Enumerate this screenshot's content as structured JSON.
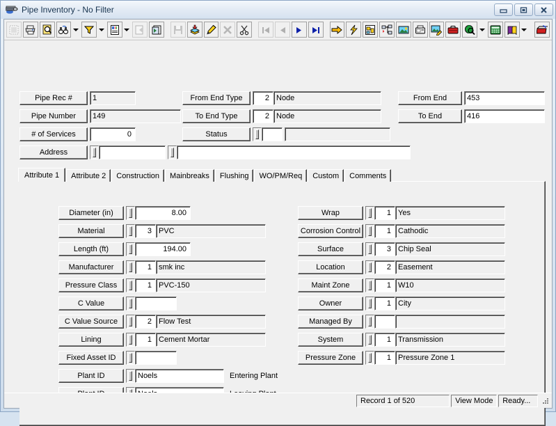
{
  "window": {
    "title": "Pipe Inventory - No Filter",
    "icon": "pipe-icon",
    "buttons": [
      {
        "name": "minimize-button",
        "glyph": "minimize"
      },
      {
        "name": "maximize-button",
        "glyph": "maximize"
      },
      {
        "name": "close-button",
        "glyph": "close"
      }
    ]
  },
  "toolbar": {
    "items": [
      {
        "name": "new-record-button",
        "icon": "grid-icon",
        "enabled": false,
        "framed": true
      },
      {
        "name": "print-button",
        "icon": "printer-icon",
        "enabled": true,
        "framed": true
      },
      {
        "name": "print-preview-button",
        "icon": "print-preview-icon",
        "enabled": true,
        "framed": true
      },
      {
        "name": "find-button",
        "icon": "binoculars-icon",
        "enabled": true,
        "framed": true
      },
      {
        "name": "find-dropdown",
        "icon": "chevron-down-icon",
        "enabled": true,
        "framed": false
      },
      {
        "name": "filter-button",
        "icon": "funnel-icon",
        "enabled": true,
        "framed": true
      },
      {
        "name": "filter-dropdown",
        "icon": "chevron-down-icon",
        "enabled": true,
        "framed": false
      },
      {
        "name": "report-button",
        "icon": "report-icon",
        "enabled": true,
        "framed": true
      },
      {
        "name": "report-dropdown",
        "icon": "chevron-down-icon",
        "enabled": true,
        "framed": false
      },
      {
        "name": "export-button",
        "icon": "export-icon",
        "enabled": false,
        "framed": true
      },
      {
        "name": "duplicate-record-button",
        "icon": "copy-records-icon",
        "enabled": true,
        "framed": true
      },
      {
        "name": "separator",
        "icon": "separator",
        "enabled": true,
        "framed": false
      },
      {
        "name": "save-button",
        "icon": "floppy-disk-icon",
        "enabled": false,
        "framed": true
      },
      {
        "name": "add-record-button",
        "icon": "add-record-icon",
        "enabled": true,
        "framed": true
      },
      {
        "name": "edit-record-button",
        "icon": "pencil-icon",
        "enabled": true,
        "framed": true
      },
      {
        "name": "delete-record-button",
        "icon": "delete-x-icon",
        "enabled": false,
        "framed": true
      },
      {
        "name": "cut-button",
        "icon": "scissors-icon",
        "enabled": true,
        "framed": true
      },
      {
        "name": "separator",
        "icon": "separator",
        "enabled": true,
        "framed": false
      },
      {
        "name": "first-record-button",
        "icon": "first-record-icon",
        "enabled": false,
        "framed": true
      },
      {
        "name": "previous-record-button",
        "icon": "previous-record-icon",
        "enabled": false,
        "framed": true
      },
      {
        "name": "next-record-button",
        "icon": "next-record-icon",
        "enabled": true,
        "framed": true
      },
      {
        "name": "last-record-button",
        "icon": "last-record-icon",
        "enabled": true,
        "framed": true
      },
      {
        "name": "separator",
        "icon": "separator",
        "enabled": true,
        "framed": false
      },
      {
        "name": "goto-button",
        "icon": "yellow-arrow-icon",
        "enabled": true,
        "framed": true
      },
      {
        "name": "quick-action-button",
        "icon": "lightning-icon",
        "enabled": true,
        "framed": true
      },
      {
        "name": "map-button",
        "icon": "map-icon",
        "enabled": true,
        "framed": true
      },
      {
        "name": "hierarchy-button",
        "icon": "hierarchy-icon",
        "enabled": true,
        "framed": true
      },
      {
        "name": "image-button",
        "icon": "picture-icon",
        "enabled": true,
        "framed": true
      },
      {
        "name": "fax-button",
        "icon": "fax-icon",
        "enabled": true,
        "framed": true
      },
      {
        "name": "edit-image-button",
        "icon": "edit-picture-icon",
        "enabled": true,
        "framed": true
      },
      {
        "name": "toolbox-button",
        "icon": "toolbox-icon",
        "enabled": true,
        "framed": true
      },
      {
        "name": "web-search-button",
        "icon": "globe-search-icon",
        "enabled": true,
        "framed": true
      },
      {
        "name": "web-dropdown",
        "icon": "chevron-down-icon",
        "enabled": true,
        "framed": false
      },
      {
        "name": "calculator-button",
        "icon": "calculator-icon",
        "enabled": true,
        "framed": true
      },
      {
        "name": "help-book-button",
        "icon": "help-book-icon",
        "enabled": true,
        "framed": true
      },
      {
        "name": "help-dropdown",
        "icon": "chevron-down-icon",
        "enabled": true,
        "framed": false
      },
      {
        "name": "separator",
        "icon": "separator",
        "enabled": true,
        "framed": false
      },
      {
        "name": "exit-button",
        "icon": "exit-icon",
        "enabled": true,
        "framed": true
      }
    ]
  },
  "header": {
    "pipe_rec": {
      "label": "Pipe Rec #",
      "value": "1"
    },
    "pipe_number": {
      "label": "Pipe Number",
      "value": "149"
    },
    "num_services": {
      "label": "# of Services",
      "value": "0"
    },
    "address": {
      "label": "Address",
      "value1": "",
      "value2": ""
    },
    "from_end_type": {
      "label": "From End Type",
      "code": "2",
      "desc": "Node"
    },
    "to_end_type": {
      "label": "To End Type",
      "code": "2",
      "desc": "Node"
    },
    "status": {
      "label": "Status",
      "code": "",
      "desc": ""
    },
    "from_end": {
      "label": "From End",
      "value": "453"
    },
    "to_end": {
      "label": "To End",
      "value": "416"
    }
  },
  "tabs": {
    "items": [
      {
        "label": "Attribute 1",
        "active": true
      },
      {
        "label": "Attribute 2",
        "active": false
      },
      {
        "label": "Construction",
        "active": false
      },
      {
        "label": "Mainbreaks",
        "active": false
      },
      {
        "label": "Flushing",
        "active": false
      },
      {
        "label": "WO/PM/Req",
        "active": false
      },
      {
        "label": "Custom",
        "active": false
      },
      {
        "label": "Comments",
        "active": false
      }
    ]
  },
  "attribute1": {
    "left": [
      {
        "label": "Diameter (in)",
        "code": null,
        "value": "8.00",
        "value_align": "right",
        "value_style": "white",
        "value_width": 80
      },
      {
        "label": "Material",
        "code": "3",
        "value": "PVC",
        "value_align": "left",
        "value_style": "gray",
        "value_width": 158
      },
      {
        "label": "Length (ft)",
        "code": null,
        "value": "194.00",
        "value_align": "right",
        "value_style": "white",
        "value_width": 80
      },
      {
        "label": "Manufacturer",
        "code": "1",
        "value": "smk inc",
        "value_align": "left",
        "value_style": "gray",
        "value_width": 158
      },
      {
        "label": "Pressure Class",
        "code": "1",
        "value": "PVC-150",
        "value_align": "left",
        "value_style": "gray",
        "value_width": 158
      },
      {
        "label": "C Value",
        "code": null,
        "value": "",
        "value_align": "right",
        "value_style": "white",
        "value_width": 60
      },
      {
        "label": "C Value Source",
        "code": "2",
        "value": "Flow Test",
        "value_align": "left",
        "value_style": "gray",
        "value_width": 158
      },
      {
        "label": "Lining",
        "code": "1",
        "value": "Cement Mortar",
        "value_align": "left",
        "value_style": "gray",
        "value_width": 158
      },
      {
        "label": "Fixed Asset ID",
        "code": null,
        "value": "",
        "value_align": "left",
        "value_style": "white",
        "value_width": 60
      },
      {
        "label": "Plant ID",
        "code": null,
        "value": "Noels",
        "value_align": "left",
        "value_style": "white",
        "value_width": 128,
        "side": "Entering Plant"
      },
      {
        "label": "Plant ID",
        "code": null,
        "value": "Noels",
        "value_align": "left",
        "value_style": "white",
        "value_width": 128,
        "side": "Leaving Plant"
      }
    ],
    "right": [
      {
        "label": "Wrap",
        "code": "1",
        "value": "Yes"
      },
      {
        "label": "Corrosion Control",
        "code": "1",
        "value": "Cathodic"
      },
      {
        "label": "Surface",
        "code": "3",
        "value": "Chip Seal"
      },
      {
        "label": "Location",
        "code": "2",
        "value": "Easement"
      },
      {
        "label": "Maint Zone",
        "code": "1",
        "value": "W10"
      },
      {
        "label": "Owner",
        "code": "1",
        "value": "City"
      },
      {
        "label": "Managed By",
        "code": "",
        "value": ""
      },
      {
        "label": "System",
        "code": "1",
        "value": "Transmission"
      },
      {
        "label": "Pressure Zone",
        "code": "1",
        "value": "Pressure Zone 1"
      }
    ]
  },
  "statusbar": {
    "record": "Record 1 of 520",
    "mode": "View Mode",
    "state": "Ready..."
  }
}
